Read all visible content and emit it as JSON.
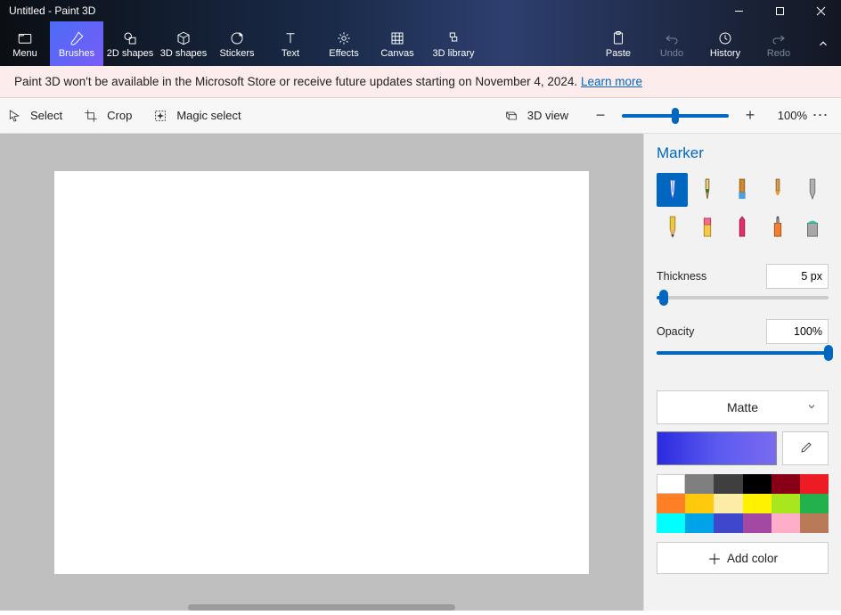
{
  "window": {
    "title": "Untitled - Paint 3D"
  },
  "ribbon": {
    "menu": "Menu",
    "items": [
      {
        "label": "Brushes",
        "icon": "brush",
        "active": true
      },
      {
        "label": "2D shapes",
        "icon": "shapes2d"
      },
      {
        "label": "3D shapes",
        "icon": "shapes3d"
      },
      {
        "label": "Stickers",
        "icon": "stickers"
      },
      {
        "label": "Text",
        "icon": "text"
      },
      {
        "label": "Effects",
        "icon": "effects"
      },
      {
        "label": "Canvas",
        "icon": "canvas"
      },
      {
        "label": "3D library",
        "icon": "library"
      }
    ],
    "right": [
      {
        "label": "Paste",
        "icon": "paste",
        "enabled": true
      },
      {
        "label": "Undo",
        "icon": "undo",
        "enabled": false
      },
      {
        "label": "History",
        "icon": "history",
        "enabled": true
      },
      {
        "label": "Redo",
        "icon": "redo",
        "enabled": false
      }
    ]
  },
  "banner": {
    "text": "Paint 3D won't be available in the Microsoft Store or receive future updates starting on November 4, 2024. ",
    "link": "Learn more"
  },
  "toolbar": {
    "select": "Select",
    "crop": "Crop",
    "magic_select": "Magic select",
    "view3d": "3D view",
    "zoom_pct": "100%"
  },
  "sidepanel": {
    "title": "Marker",
    "brushes": [
      "marker",
      "calligraphy",
      "oil",
      "watercolor",
      "pixel",
      "pencil",
      "eraser",
      "crayon",
      "spray",
      "fill"
    ],
    "selected_brush": 0,
    "thickness_label": "Thickness",
    "thickness_value": "5 px",
    "thickness_pct": 4,
    "opacity_label": "Opacity",
    "opacity_value": "100%",
    "opacity_pct": 100,
    "material": "Matte",
    "current_color": "#4a4ae8",
    "palette": [
      "#ffffff",
      "#7f7f7f",
      "#3f3f3f",
      "#000000",
      "#880015",
      "#ed1c24",
      "#ff7f27",
      "#ffc90e",
      "#fdeca6",
      "#fff200",
      "#a8e61d",
      "#22b14c",
      "#00ffff",
      "#00a2e8",
      "#3f48cc",
      "#a349a4",
      "#ffaec9",
      "#b97a57"
    ],
    "add_color": "Add color"
  }
}
